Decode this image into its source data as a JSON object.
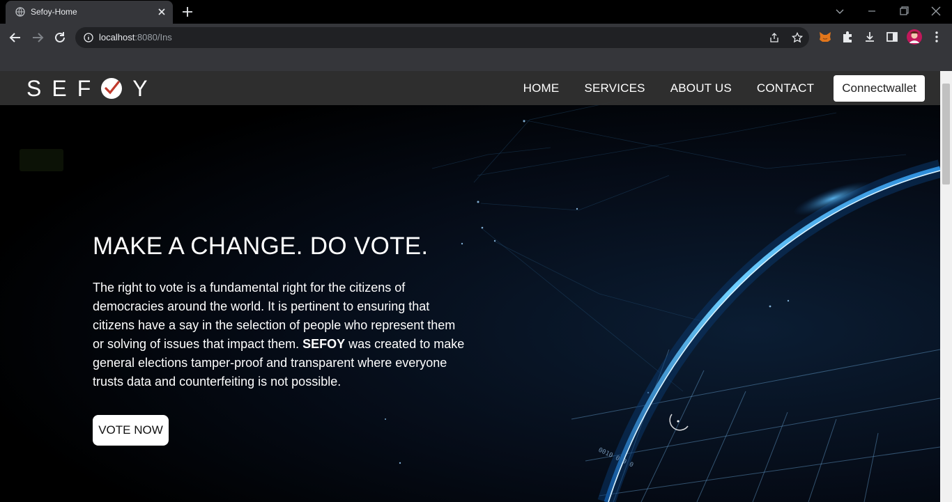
{
  "browser": {
    "tab_title": "Sefoy-Home",
    "url_host": "localhost",
    "url_rest": ":8080/Ins"
  },
  "page": {
    "logo_left": "SEF",
    "logo_right": "Y",
    "nav": {
      "home": "HOME",
      "services": "SERVICES",
      "about": "ABOUT US",
      "contact": "CONTACT",
      "connect": "Connectwallet"
    },
    "hero": {
      "title": "MAKE A CHANGE. DO VOTE.",
      "text_before": "The right to vote is a fundamental right for the citizens of democracies around the world. It is pertinent to ensuring that citizens have a say in the selection of people who represent them or solving of issues that impact them. ",
      "text_bold": "SEFOY",
      "text_after": " was created to make general elections tamper-proof and transparent where everyone trusts data and counterfeiting is not possible.",
      "cta": "VOTE NOW"
    }
  },
  "colors": {
    "chrome_dark": "#000000",
    "chrome_toolbar": "#35363a",
    "navbar": "#323232",
    "accent_glow": "#3a9be6",
    "check_red": "#c0392b"
  }
}
